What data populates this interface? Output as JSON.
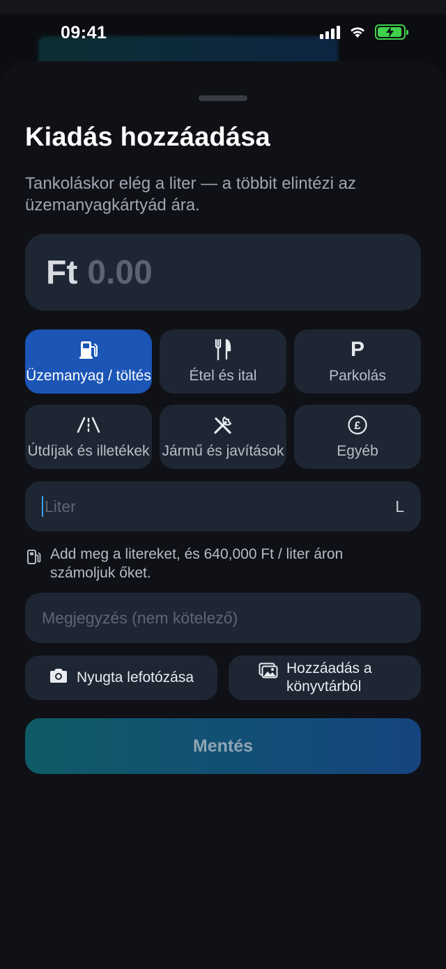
{
  "status_bar": {
    "time": "09:41"
  },
  "sheet": {
    "title": "Kiadás hozzáadása",
    "subtitle": "Tankoláskor elég a liter — a többit elintézi az üzemanyagkártyád ára."
  },
  "amount": {
    "currency": "Ft",
    "value": "0.00"
  },
  "categories": [
    {
      "label": "Üzemanyag / töltés",
      "icon": "fuel-pump-icon",
      "selected": true
    },
    {
      "label": "Étel és ital",
      "icon": "fork-knife-icon",
      "selected": false
    },
    {
      "label": "Parkolás",
      "icon": "parking-icon",
      "icon_text": "P",
      "selected": false
    },
    {
      "label": "Útdíjak és illetékek",
      "icon": "road-icon",
      "selected": false
    },
    {
      "label": "Jármű és javítások",
      "icon": "tools-icon",
      "selected": false
    },
    {
      "label": "Egyéb",
      "icon": "pound-circle-icon",
      "selected": false
    }
  ],
  "liter_field": {
    "placeholder": "Liter",
    "unit": "L"
  },
  "hint": {
    "text": "Add meg a litereket, és 640,000 Ft / liter áron számoljuk őket.",
    "icon": "fuel-pump-icon"
  },
  "note_field": {
    "placeholder": "Megjegyzés (nem kötelező)"
  },
  "photo_buttons": {
    "take_photo": "Nyugta lefotózása",
    "from_library": "Hozzáadás a könyvtárból"
  },
  "save_button": {
    "label": "Mentés"
  },
  "colors": {
    "accent": "#1b55b6",
    "surface": "#1f2633",
    "background": "#0f1116"
  }
}
